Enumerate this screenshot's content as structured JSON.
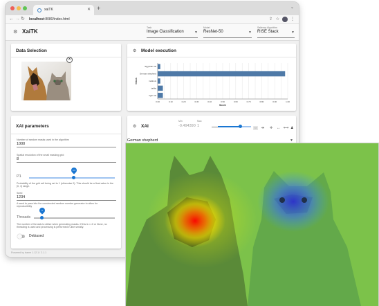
{
  "browser": {
    "tab_title": "xaiTK",
    "url_host": "localhost",
    "url_rest": ":8080/index.html"
  },
  "app": {
    "title": "XaiTK",
    "selects": [
      {
        "label": "Task",
        "value": "Image Classification"
      },
      {
        "label": "Model",
        "value": "ResNet-50"
      },
      {
        "label": "Saliency Algorithm",
        "value": "RISE Stack"
      }
    ]
  },
  "data_selection": {
    "title": "Data Selection"
  },
  "model_execution": {
    "title": "Model execution",
    "chart_data": {
      "type": "bar",
      "orientation": "horizontal",
      "categories": [
        "Egyptian cat",
        "German shepherd",
        "malinois",
        "tabby",
        "tiger cat"
      ],
      "values": [
        0.02,
        0.98,
        0.02,
        0.04,
        0.04
      ],
      "xlabel": "Score",
      "ylabel": "Class",
      "xticks": [
        "0.00",
        "0.05",
        "0.10",
        "0.15",
        "0.20",
        "0.25",
        "0.30",
        "0.35",
        "0.40",
        "0.45",
        "0.50",
        "0.55",
        "0.60",
        "0.65",
        "0.70",
        "0.75",
        "0.80",
        "0.85",
        "0.90",
        "0.95",
        "1.00"
      ],
      "xlim": [
        0,
        1
      ],
      "color": "#4e79a7"
    }
  },
  "xai_params": {
    "title": "XAI parameters",
    "fields": [
      {
        "label": "Number of random masks used in the algorithm",
        "value": "1000"
      },
      {
        "label": "Spatial resolution of the small masking grid",
        "value": "8"
      }
    ],
    "p1": {
      "label": "P1",
      "value": "0.5",
      "help": "Probability of the grid cell being set to 1 (otherwise 0). This should be a float value in the [0, 1] range."
    },
    "seed": {
      "label": "Seed",
      "value": "1234",
      "help": "A seed to pass into the constructed random number generator to allow for reproducibility"
    },
    "threads": {
      "label": "Threads",
      "value": "0",
      "help": "The number of threads to utilize when generating masks. If this is <=0 or None, no threading is used and processing is performed in-line serially."
    },
    "debiased": {
      "label": "Debiased",
      "on": false
    }
  },
  "xai": {
    "title": "XAI",
    "min_label": "Min",
    "min_value": "-0.494390",
    "max_label": "Max",
    "max_value": "1",
    "slider_level": 0.68,
    "class_selected": "German shepherd"
  },
  "footer": "Powered by trame 1.12.1 / 2.1.1",
  "colors": {
    "accent": "#1976d2",
    "bar": "#4e79a7"
  },
  "icons": [
    "xaitk-logo-icon",
    "back-icon",
    "forward-icon",
    "reload-icon",
    "info-icon",
    "share-icon",
    "star-icon",
    "more-icon",
    "close-icon",
    "fit-icon",
    "zoom-icon",
    "move-icon",
    "arrows-icon",
    "person-icon"
  ]
}
